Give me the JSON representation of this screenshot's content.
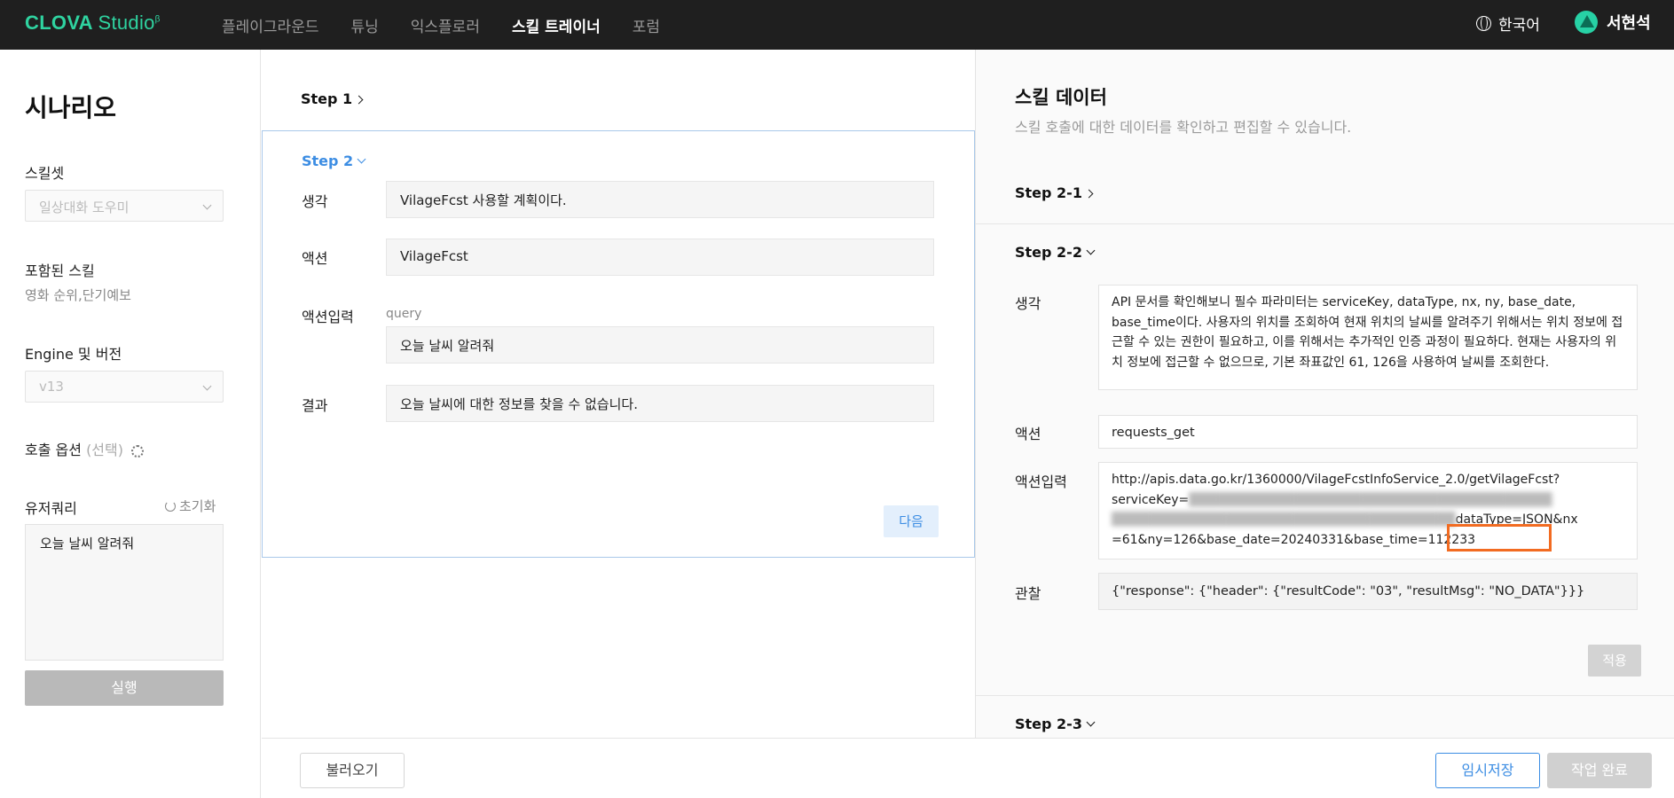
{
  "header": {
    "logo_brand": "CLOVA",
    "logo_product": "Studio",
    "logo_sup": "β",
    "nav": [
      "플레이그라운드",
      "튜닝",
      "익스플로러",
      "스킬 트레이너",
      "포럼"
    ],
    "active_nav": "스킬 트레이너",
    "language": "한국어",
    "user_name": "서현석"
  },
  "left": {
    "title": "시나리오",
    "skillset_label": "스킬셋",
    "skillset_value": "일상대화 도우미",
    "included_label": "포함된 스킬",
    "included_value": "영화 순위,단기예보",
    "engine_label": "Engine 및 버전",
    "engine_value": "v13",
    "call_option_label": "호출 옵션",
    "call_option_optional": "(선택)",
    "user_query_label": "유저쿼리",
    "reset_label": "초기화",
    "user_query_value": "오늘 날씨 알려줘",
    "run_button": "실행"
  },
  "middle": {
    "step1": "Step 1",
    "step2": "Step 2",
    "thought_label": "생각",
    "thought_value": "VilageFcst 사용할 계획이다.",
    "action_label": "액션",
    "action_value": "VilageFcst",
    "action_input_label": "액션입력",
    "action_input_param": "query",
    "action_input_value": "오늘 날씨 알려줘",
    "result_label": "결과",
    "result_value": "오늘 날씨에 대한 정보를 찾을 수 없습니다.",
    "next_button": "다음"
  },
  "right": {
    "title": "스킬 데이터",
    "subtitle": "스킬 호출에 대한 데이터를 확인하고 편집할 수 있습니다.",
    "step2_1": "Step 2-1",
    "step2_2": "Step 2-2",
    "step2_3": "Step 2-3",
    "thought_label": "생각",
    "thought_value": "API 문서를 확인해보니 필수 파라미터는 serviceKey, dataType, nx, ny, base_date, base_time이다. 사용자의 위치를 조회하여 현재 위치의 날씨를 알려주기 위해서는 위치 정보에 접근할 수 있는 권한이 필요하고, 이를 위해서는 추가적인 인증 과정이 필요하다. 현재는 사용자의 위치 정보에 접근할 수 없으므로, 기본 좌표값인 61, 126을 사용하여 날씨를 조회한다.",
    "action_label": "액션",
    "action_value": "requests_get",
    "action_input_label": "액션입력",
    "action_input_line1": "http://apis.data.go.kr/1360000/VilageFcstInfoService_2.0/getVilageFcst?",
    "action_input_line2_visible": "serviceKey=",
    "action_input_line3_visible": "dataType=JSON&nx",
    "action_input_line4": "=61&ny=126&base_date=20240331&base_time=112233",
    "observation_label": "관찰",
    "observation_value": "{\"response\": {\"header\": {\"resultCode\": \"03\", \"resultMsg\": \"NO_DATA\"}}}",
    "apply_button": "적용"
  },
  "bottom": {
    "load_button": "불러오기",
    "save_button": "임시저장",
    "done_button": "작업 완료"
  },
  "colors": {
    "topbar": "#1f1f1f",
    "accent": "#3c8de3",
    "brand": "#2fd3a0",
    "highlight": "#f26b21"
  }
}
